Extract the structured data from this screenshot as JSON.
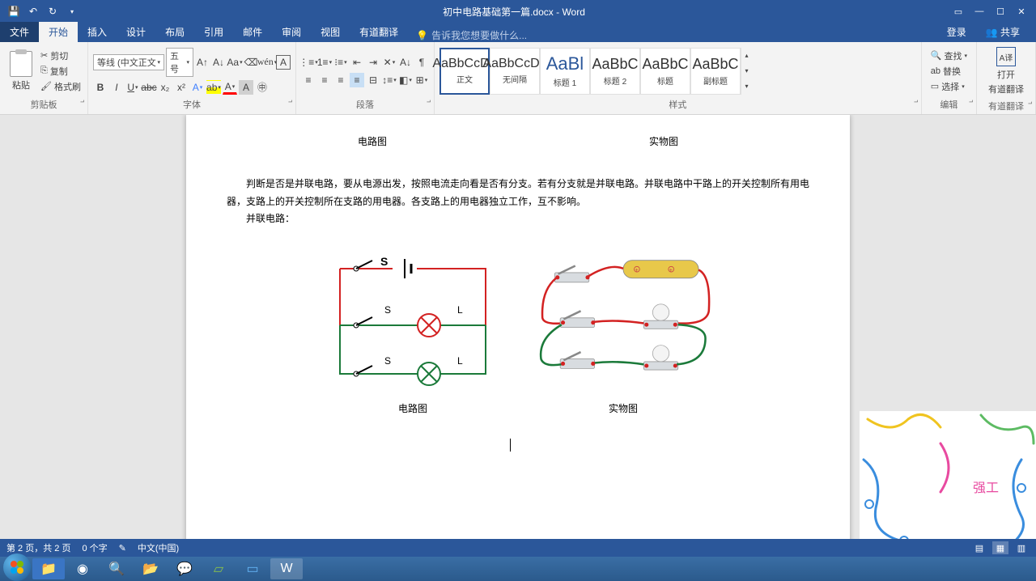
{
  "titlebar": {
    "doc_title": "初中电路基础第一篇.docx - Word"
  },
  "tabs": {
    "file": "文件",
    "home": "开始",
    "insert": "插入",
    "design": "设计",
    "layout": "布局",
    "references": "引用",
    "mailings": "邮件",
    "review": "审阅",
    "view": "视图",
    "youdao": "有道翻译",
    "tell_me": "告诉我您想要做什么...",
    "login": "登录",
    "share": "共享"
  },
  "ribbon": {
    "clipboard": {
      "paste": "粘贴",
      "cut": "剪切",
      "copy": "复制",
      "painter": "格式刷",
      "label": "剪贴板"
    },
    "font": {
      "name": "等线 (中文正文",
      "size": "五号",
      "label": "字体"
    },
    "para": {
      "label": "段落"
    },
    "styles": {
      "label": "样式",
      "items": [
        {
          "preview": "AaBbCcDd",
          "name": "正文",
          "active": true
        },
        {
          "preview": "AaBbCcDd",
          "name": "无间隔"
        },
        {
          "preview": "AaBl",
          "name": "标题 1",
          "big": true
        },
        {
          "preview": "AaBbC",
          "name": "标题 2"
        },
        {
          "preview": "AaBbC",
          "name": "标题"
        },
        {
          "preview": "AaBbC",
          "name": "副标题"
        }
      ]
    },
    "editing": {
      "find": "查找",
      "replace": "替换",
      "select": "选择",
      "label": "编辑"
    },
    "addin": {
      "line1": "打开",
      "line2": "有道翻译",
      "label": "有道翻译"
    }
  },
  "document": {
    "caption1_left": "电路图",
    "caption1_right": "实物图",
    "body": "判断是否是并联电路，要从电源出发，按照电流走向看是否有分支。若有分支就是并联电路。并联电路中干路上的开关控制所有用电器，支路上的开关控制所在支路的用电器。各支路上的用电器独立工作，互不影响。",
    "body2": "并联电路：",
    "caption2_left": "电路图",
    "caption2_right": "实物图",
    "diagram_labels": {
      "s_main": "S",
      "s1": "S",
      "s2": "S",
      "l1": "L",
      "l2": "L"
    }
  },
  "statusbar": {
    "page": "第 2 页，共 2 页",
    "words": "0 个字",
    "lang": "中文(中国)"
  },
  "overlay": {
    "label": "强工"
  }
}
